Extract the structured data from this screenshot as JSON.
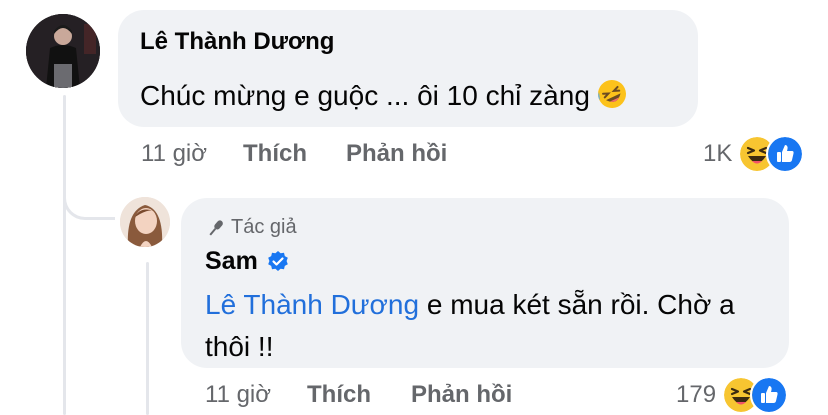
{
  "comment": {
    "author": "Lê Thành Dương",
    "text": "Chúc mừng e guộc ... ôi 10 chỉ zàng",
    "text_emoji_icon": "rolling-on-floor-laughing-emoji",
    "time": "11 giờ",
    "like_label": "Thích",
    "reply_label": "Phản hồi",
    "reaction_count": "1K",
    "reaction_icons": [
      "haha-reaction-icon",
      "like-reaction-icon"
    ]
  },
  "reply": {
    "author_badge": "Tác giả",
    "author_badge_icon": "microphone-icon",
    "author": "Sam",
    "verified_icon": "verified-badge-icon",
    "mention": "Lê Thành Dương",
    "text": " e mua két sẵn rồi. Chờ a thôi !!",
    "time": "11 giờ",
    "like_label": "Thích",
    "reply_label": "Phản hồi",
    "reaction_count": "179",
    "reaction_icons": [
      "haha-reaction-icon",
      "like-reaction-icon"
    ]
  },
  "colors": {
    "bubble": "#f0f2f5",
    "mention": "#216fdb",
    "meta_text": "#65676b",
    "verified": "#1877f2",
    "like_blue": "#1877f2",
    "haha_yellow": "#f7c531"
  }
}
